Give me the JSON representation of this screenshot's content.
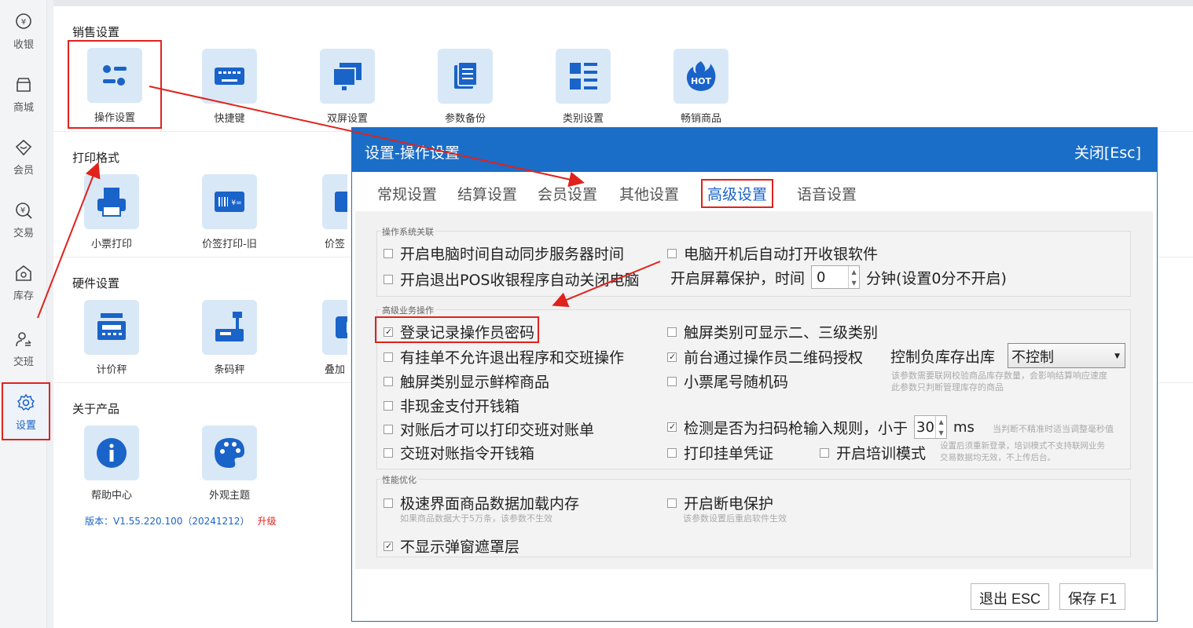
{
  "nav": {
    "items": [
      {
        "label": "收银",
        "icon": "cashier-icon"
      },
      {
        "label": "商城",
        "icon": "store-icon"
      },
      {
        "label": "会员",
        "icon": "member-icon"
      },
      {
        "label": "交易",
        "icon": "trade-icon"
      },
      {
        "label": "库存",
        "icon": "inventory-icon"
      },
      {
        "label": "交班",
        "icon": "shift-icon"
      },
      {
        "label": "设置",
        "icon": "gear-icon"
      }
    ]
  },
  "main": {
    "sections": {
      "sales": "销售设置",
      "print": "打印格式",
      "hardware": "硬件设置",
      "about": "关于产品"
    },
    "sales_tiles": [
      "操作设置",
      "快捷键",
      "双屏设置",
      "参数备份",
      "类别设置",
      "畅销商品"
    ],
    "print_tiles": [
      "小票打印",
      "价签打印-旧",
      "价签"
    ],
    "hardware_tiles": [
      "计价秤",
      "条码秤",
      "叠加"
    ],
    "about_tiles": [
      "帮助中心",
      "外观主题"
    ],
    "version": "版本：V1.55.220.100（20241212）",
    "upgrade": "升级",
    "hot_badge": "HOT"
  },
  "dialog": {
    "title": "设置-操作设置",
    "close": "关闭[Esc]",
    "tabs": [
      "常规设置",
      "结算设置",
      "会员设置",
      "其他设置",
      "高级设置",
      "语音设置"
    ],
    "active_tab": "高级设置",
    "groups": {
      "os": "操作系统关联",
      "business": "高级业务操作",
      "perf": "性能优化"
    },
    "opts": {
      "sync_time": "开启电脑时间自动同步服务器时间",
      "auto_start": "电脑开机后自动打开收银软件",
      "shutdown": "开启退出POS收银程序自动关闭电脑",
      "screensaver": "开启屏幕保护，时间",
      "screensaver_val": "0",
      "screensaver_unit": "分钟(设置0分不开启)",
      "log_pwd": "登录记录操作员密码",
      "touch_cat": "触屏类别可显示二、三级类别",
      "hang_exit": "有挂单不允许退出程序和交班操作",
      "qr_auth": "前台通过操作员二维码授权",
      "neg_stock_label": "控制负库存出库",
      "neg_stock_val": "不控制",
      "neg_stock_hint1": "该参数需要联网校验商品库存数量，会影响结算响应速度",
      "neg_stock_hint2": "此参数只判断管理库存的商品",
      "fresh_juice": "触屏类别显示鲜榨商品",
      "random_receipt": "小票尾号随机码",
      "non_cash_drawer": "非现金支付开钱箱",
      "print_after_check": "对账后才可以打印交班对账单",
      "scanner_detect": "检测是否为扫码枪输入规则，小于",
      "scanner_val": "30",
      "scanner_unit": "ms",
      "scanner_hint": "当判断不精准时适当调整毫秒值",
      "shift_drawer": "交班对账指令开钱箱",
      "print_hang": "打印挂单凭证",
      "training": "开启培训模式",
      "training_hint1": "设置后须重新登录，培训模式不支持联网业务",
      "training_hint2": "交易数据均无效，不上传后台。",
      "fast_load": "极速界面商品数据加载内存",
      "fast_load_hint": "如果商品数据大于5万条，该参数不生效",
      "power_protect": "开启断电保护",
      "power_protect_hint": "该参数设置后重启软件生效",
      "no_mask": "不显示弹窗遮罩层"
    },
    "exit_btn": "退出 ESC",
    "save_btn": "保存 F1"
  },
  "colors": {
    "accent": "#1a6ec8",
    "annotation": "#e0221d",
    "tile_bg": "#d9e8f7"
  }
}
